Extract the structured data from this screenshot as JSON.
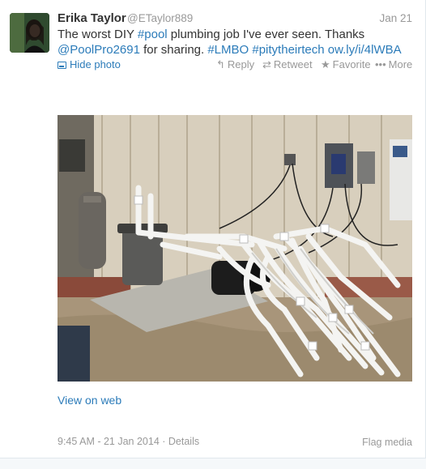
{
  "tweet": {
    "fullname": "Erika Taylor",
    "username": "@ETaylor889",
    "date": "Jan 21",
    "text": {
      "part1": "The worst DIY ",
      "hashtag_pool": "#pool",
      "part2": " plumbing job I've ever seen. Thanks ",
      "mention": "@PoolPro2691",
      "part3": " for sharing.  ",
      "hashtag_lmbo": "#LMBO",
      "space": " ",
      "hashtag_pity": "#pitytheirtech",
      "space2": " ",
      "short_link": "ow.ly/i/4lWBA"
    },
    "actions": {
      "hide_photo": "Hide photo",
      "reply": "Reply",
      "retweet": "Retweet",
      "favorite": "Favorite",
      "more": "More"
    },
    "view_on_web": "View on web",
    "footer": {
      "time": "9:45 AM - 21 Jan 2014",
      "separator": " · ",
      "details": "Details",
      "flag_media": "Flag media"
    }
  },
  "colors": {
    "link": "#2b7bb9",
    "muted": "#999999",
    "text": "#333333"
  },
  "icons": {
    "hide_photo": "photo-icon",
    "reply": "reply-arrow-icon",
    "retweet": "retweet-icon",
    "favorite": "star-icon",
    "more": "ellipsis-icon"
  }
}
